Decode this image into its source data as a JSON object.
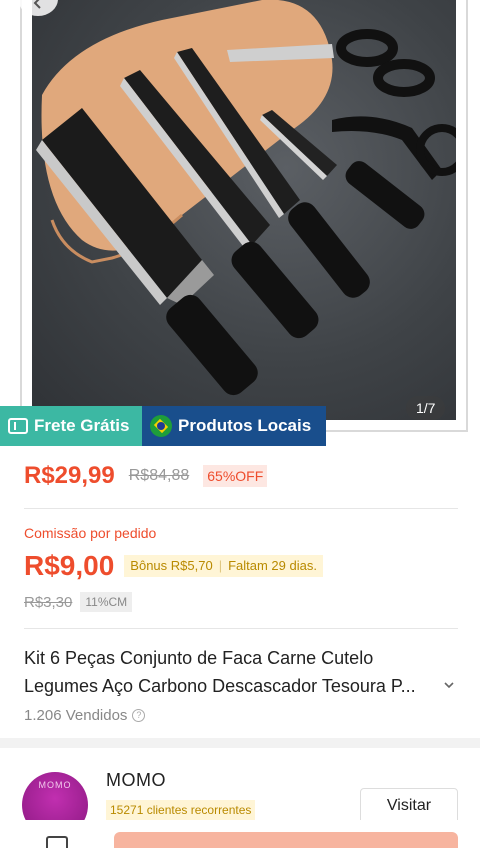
{
  "gallery": {
    "counter": "1/7"
  },
  "badges": {
    "free_shipping": "Frete Grátis",
    "local_products": "Produtos Locais"
  },
  "price": {
    "current": "R$29,99",
    "original": "R$84,88",
    "discount": "65%OFF"
  },
  "commission": {
    "label": "Comissão por pedido",
    "value": "R$9,00",
    "bonus": "Bônus R$5,70",
    "remaining": "Faltam 29 dias.",
    "old_value": "R$3,30",
    "rate": "11%CM"
  },
  "product": {
    "title_line1": "Kit 6 Peças Conjunto de Faca Carne Cutelo",
    "title_line2": "Legumes Aço Carbono Descascador Tesoura P...",
    "sold": "1.206 Vendidos"
  },
  "shop": {
    "avatar_text": "MOMO",
    "name": "MOMO",
    "customers": "15271 clientes recorrentes",
    "visit_label": "Visitar"
  },
  "colors": {
    "accent": "#ee4d2d",
    "free_badge": "#3cb8a3",
    "local_badge": "#194e8c",
    "bonus_bg": "#fff5d6"
  }
}
